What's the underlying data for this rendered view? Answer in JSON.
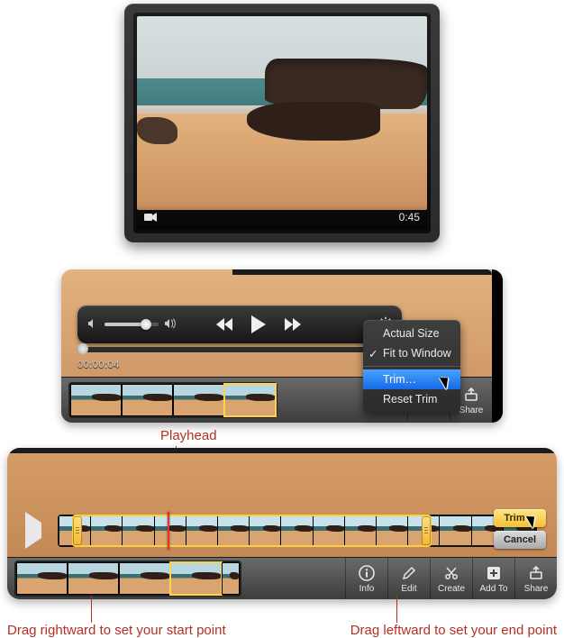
{
  "preview": {
    "duration_label": "0:45"
  },
  "controls": {
    "volume_percent": 70,
    "timecode": "00:00:04"
  },
  "popup": {
    "actual_size": "Actual Size",
    "fit_to_window": "Fit to Window",
    "trim": "Trim…",
    "reset_trim": "Reset Trim"
  },
  "toolbar": {
    "info": "Info",
    "edit": "Edit",
    "create": "Create",
    "add_to": "Add To",
    "share": "Share"
  },
  "trim_buttons": {
    "trim": "Trim",
    "cancel": "Cancel"
  },
  "annotations": {
    "playhead": "Playhead",
    "start": "Drag rightward to set your start point",
    "end": "Drag leftward to set your end point"
  },
  "trim": {
    "frame_count": 15,
    "selection_start_pct": 3,
    "selection_end_pct": 78,
    "playhead_pct": 23
  }
}
